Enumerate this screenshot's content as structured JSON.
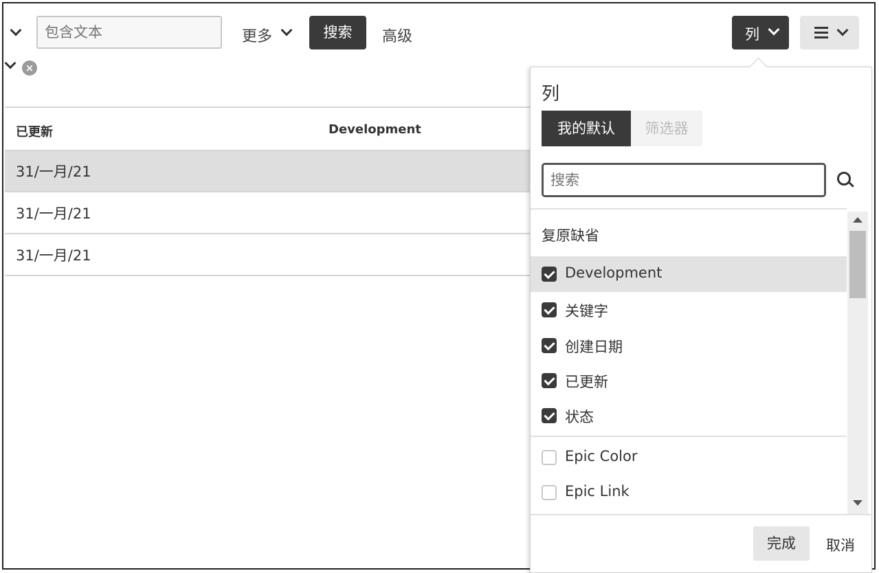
{
  "toolbar": {
    "filter_placeholder": "包含文本",
    "more_label": "更多",
    "search_label": "搜索",
    "advanced_label": "高级",
    "columns_label": "列"
  },
  "table": {
    "headers": [
      "已更新",
      "Development"
    ],
    "rows": [
      "31/一月/21",
      "31/一月/21",
      "31/一月/21"
    ]
  },
  "column_picker": {
    "title": "列",
    "tabs": [
      "我的默认",
      "筛选器"
    ],
    "search_placeholder": "搜索",
    "reset_label": "复原缺省",
    "items": [
      {
        "label": "Development",
        "checked": true
      },
      {
        "label": "关键字",
        "checked": true
      },
      {
        "label": "创建日期",
        "checked": true
      },
      {
        "label": "已更新",
        "checked": true
      },
      {
        "label": "状态",
        "checked": true
      },
      {
        "label": "Epic Color",
        "checked": false
      },
      {
        "label": "Epic Link",
        "checked": false
      }
    ],
    "done_label": "完成",
    "cancel_label": "取消"
  }
}
